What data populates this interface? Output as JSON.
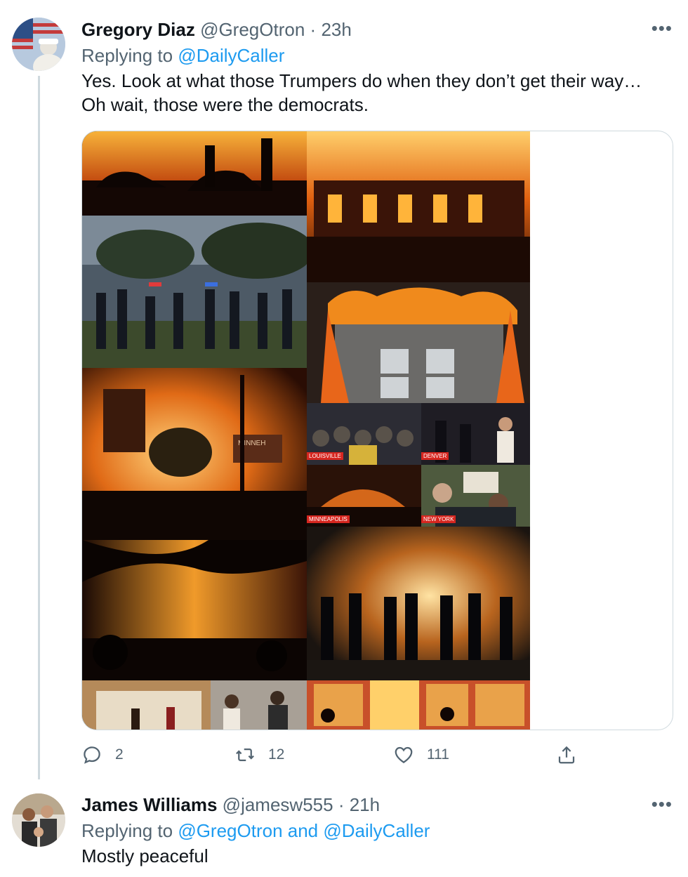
{
  "tweets": [
    {
      "author_name": "Gregory Diaz",
      "handle": "@GregOtron",
      "separator": "·",
      "time": "23h",
      "replying_prefix": "Replying to",
      "replying_to": "@DailyCaller",
      "text_lines": [
        "Yes. Look at what those Trumpers do when they don’t get their way…",
        "Oh wait, those were the democrats."
      ],
      "more": "•••",
      "media": {
        "city_labels": [
          "LOUISVILLE",
          "DENVER",
          "MINNEAPOLIS",
          "NEW YORK"
        ],
        "sign_text": "MINNEH"
      },
      "actions": {
        "replies": "2",
        "retweets": "12",
        "likes": "111"
      }
    },
    {
      "author_name": "James Williams",
      "handle": "@jamesw555",
      "separator": "·",
      "time": "21h",
      "replying_prefix": "Replying to",
      "replying_to": "@GregOtron and @DailyCaller",
      "text_lines": [
        "Mostly peaceful"
      ],
      "more": "•••"
    }
  ],
  "icons": {
    "reply": "reply-icon",
    "retweet": "retweet-icon",
    "like": "heart-icon",
    "share": "share-icon",
    "more": "more-icon"
  },
  "colors": {
    "link": "#1d9bf0",
    "secondary_text": "#536471",
    "primary_text": "#0f1419",
    "border": "#cfd9de"
  }
}
